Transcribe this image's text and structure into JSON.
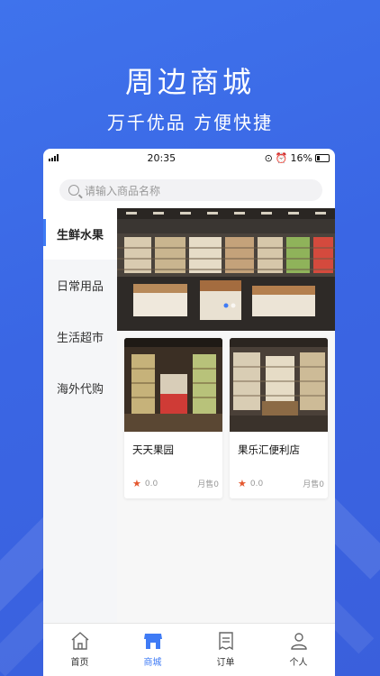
{
  "hero": {
    "title": "周边商城",
    "subtitle": "万千优品  方便快捷"
  },
  "status": {
    "time": "20:35",
    "battery": "16%"
  },
  "search": {
    "placeholder": "请输入商品名称"
  },
  "sidebar": {
    "items": [
      {
        "label": "生鲜水果",
        "active": true
      },
      {
        "label": "日常用品",
        "active": false
      },
      {
        "label": "生活超市",
        "active": false
      },
      {
        "label": "海外代购",
        "active": false
      }
    ]
  },
  "stores": [
    {
      "name": "天天果园",
      "rating": "0.0",
      "sales": "月售0"
    },
    {
      "name": "果乐汇便利店",
      "rating": "0.0",
      "sales": "月售0"
    }
  ],
  "tabbar": {
    "items": [
      {
        "label": "首页",
        "icon": "home-icon",
        "active": false
      },
      {
        "label": "商城",
        "icon": "shop-icon",
        "active": true
      },
      {
        "label": "订单",
        "icon": "order-icon",
        "active": false
      },
      {
        "label": "个人",
        "icon": "profile-icon",
        "active": false
      }
    ]
  },
  "colors": {
    "accent": "#3f7bf5",
    "background": "#3f73ec",
    "star": "#e4572e"
  }
}
